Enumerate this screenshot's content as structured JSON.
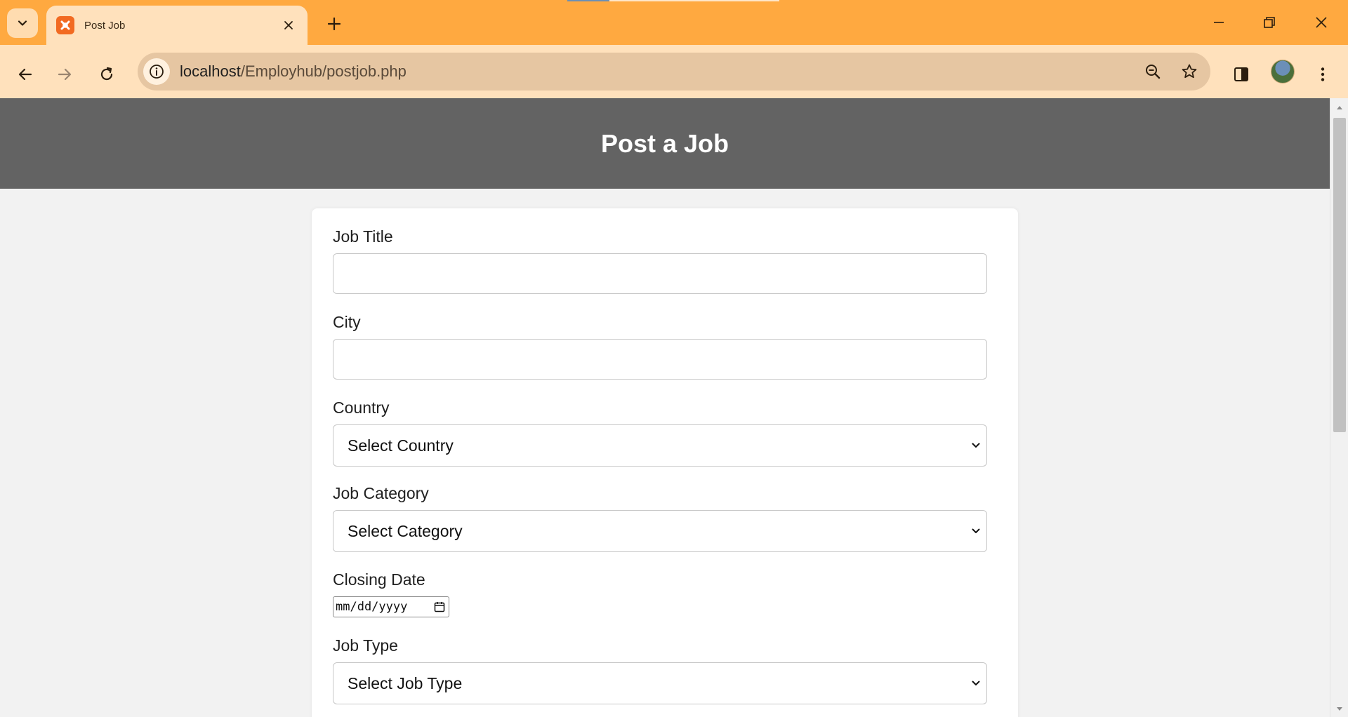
{
  "browser": {
    "tab": {
      "title": "Post Job",
      "icon": "xampp-icon"
    },
    "url_host": "localhost",
    "url_path": "/Employhub/postjob.php",
    "icons": {
      "tab_search": "chevron-down-icon",
      "close_tab": "close-icon",
      "new_tab": "plus-icon",
      "back": "arrow-left-icon",
      "forward": "arrow-right-icon",
      "reload": "reload-icon",
      "site_info": "info-icon",
      "zoom": "zoom-out-icon",
      "bookmark": "star-icon",
      "side_panel": "side-panel-icon",
      "menu": "kebab-menu-icon",
      "minimize": "minimize-icon",
      "restore": "restore-icon",
      "close_window": "close-icon"
    },
    "colors": {
      "tabbar": "#ffa940",
      "toolbar": "#ffe1bc",
      "omnibox": "#e6c6a2"
    }
  },
  "page": {
    "title": "Post a Job",
    "header_color": "#636363",
    "form": {
      "job_title": {
        "label": "Job Title",
        "value": ""
      },
      "city": {
        "label": "City",
        "value": ""
      },
      "country": {
        "label": "Country",
        "selected": "Select Country"
      },
      "category": {
        "label": "Job Category",
        "selected": "Select Category"
      },
      "closing_date": {
        "label": "Closing Date",
        "placeholder": "mm/dd/yyyy"
      },
      "job_type": {
        "label": "Job Type",
        "selected": "Select Job Type"
      }
    }
  }
}
